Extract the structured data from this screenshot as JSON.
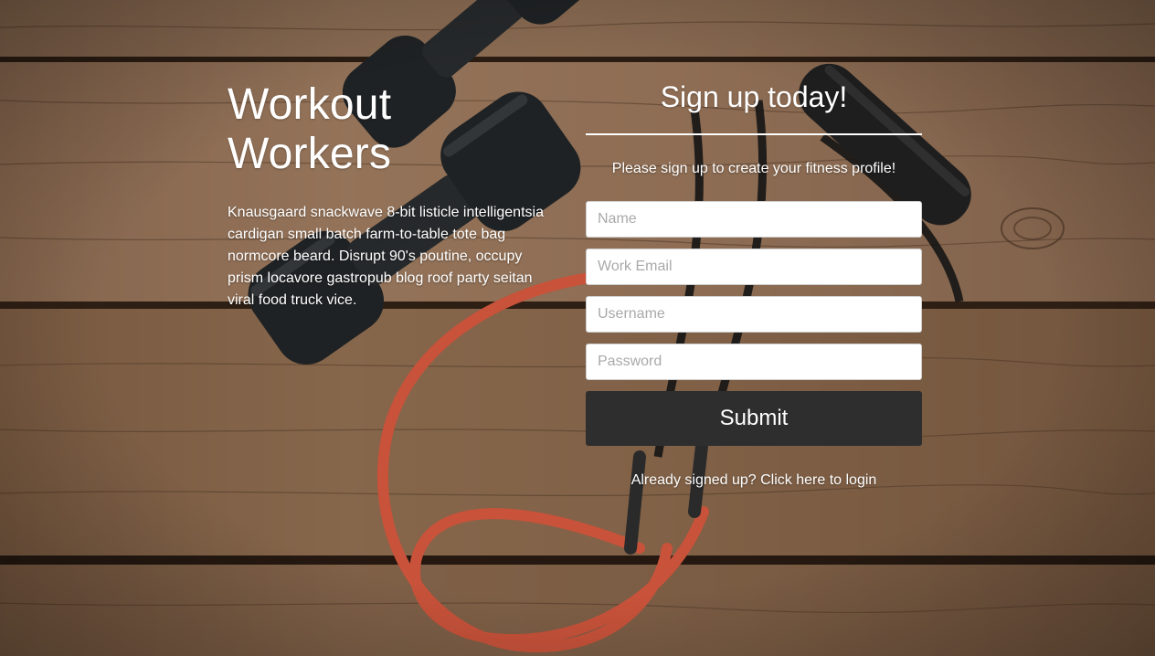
{
  "hero": {
    "title_line1": "Workout",
    "title_line2": "Workers",
    "blurb": "Knausgaard snackwave 8-bit listicle intelligentsia cardigan small batch farm-to-table tote bag normcore beard. Disrupt 90's poutine, occupy prism locavore gastropub blog roof party seitan viral food truck vice."
  },
  "signup": {
    "heading": "Sign up today!",
    "subtitle": "Please sign up to create your fitness profile!",
    "fields": {
      "name_placeholder": "Name",
      "email_placeholder": "Work Email",
      "username_placeholder": "Username",
      "password_placeholder": "Password"
    },
    "submit_label": "Submit",
    "login_prompt": "Already signed up?",
    "login_link": "Click here to login"
  },
  "colors": {
    "wood": "#7a5a40",
    "button": "#2e2e2e",
    "text": "#ffffff",
    "band": "#c8523a"
  },
  "background": {
    "description_icons": [
      "dumbbell-icon",
      "resistance-band-icon"
    ]
  }
}
